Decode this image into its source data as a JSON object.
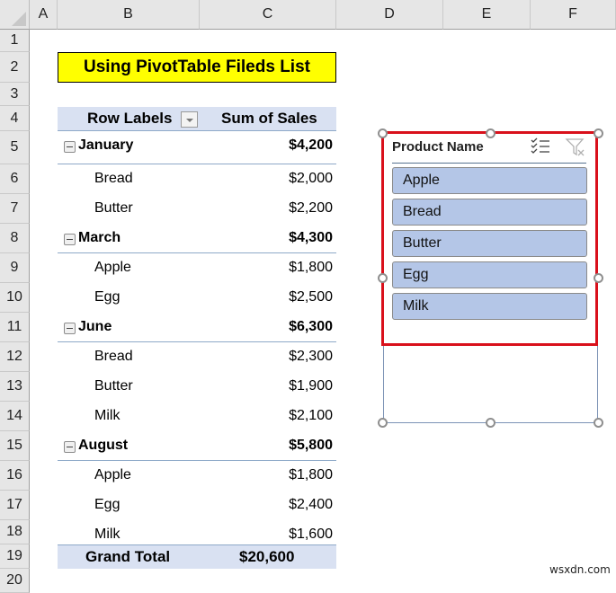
{
  "columns": [
    "A",
    "B",
    "C",
    "D",
    "E",
    "F"
  ],
  "rows": [
    "1",
    "2",
    "3",
    "4",
    "5",
    "6",
    "7",
    "8",
    "9",
    "10",
    "11",
    "12",
    "13",
    "14",
    "15",
    "16",
    "17",
    "18",
    "19",
    "20"
  ],
  "title": "Using PivotTable Fileds List",
  "pivot": {
    "row_labels_header": "Row Labels",
    "values_header": "Sum of Sales",
    "rows": [
      {
        "type": "month",
        "label": "January",
        "value": "$4,200"
      },
      {
        "type": "item",
        "label": "Bread",
        "value": "$2,000"
      },
      {
        "type": "item",
        "label": "Butter",
        "value": "$2,200"
      },
      {
        "type": "month",
        "label": "March",
        "value": "$4,300"
      },
      {
        "type": "item",
        "label": "Apple",
        "value": "$1,800"
      },
      {
        "type": "item",
        "label": "Egg",
        "value": "$2,500"
      },
      {
        "type": "month",
        "label": "June",
        "value": "$6,300"
      },
      {
        "type": "item",
        "label": "Bread",
        "value": "$2,300"
      },
      {
        "type": "item",
        "label": "Butter",
        "value": "$1,900"
      },
      {
        "type": "item",
        "label": "Milk",
        "value": "$2,100"
      },
      {
        "type": "month",
        "label": "August",
        "value": "$5,800"
      },
      {
        "type": "item",
        "label": "Apple",
        "value": "$1,800"
      },
      {
        "type": "item",
        "label": "Egg",
        "value": "$2,400"
      },
      {
        "type": "item",
        "label": "Milk",
        "value": "$1,600"
      }
    ],
    "grand_total_label": "Grand Total",
    "grand_total_value": "$20,600"
  },
  "slicer": {
    "header": "Product Name",
    "icons": [
      "multi-select-icon",
      "clear-filter-icon"
    ],
    "items": [
      "Apple",
      "Bread",
      "Butter",
      "Egg",
      "Milk"
    ],
    "highlight_color": "#d9101b",
    "item_color": "#b4c6e7"
  },
  "watermark": "wsxdn.com"
}
